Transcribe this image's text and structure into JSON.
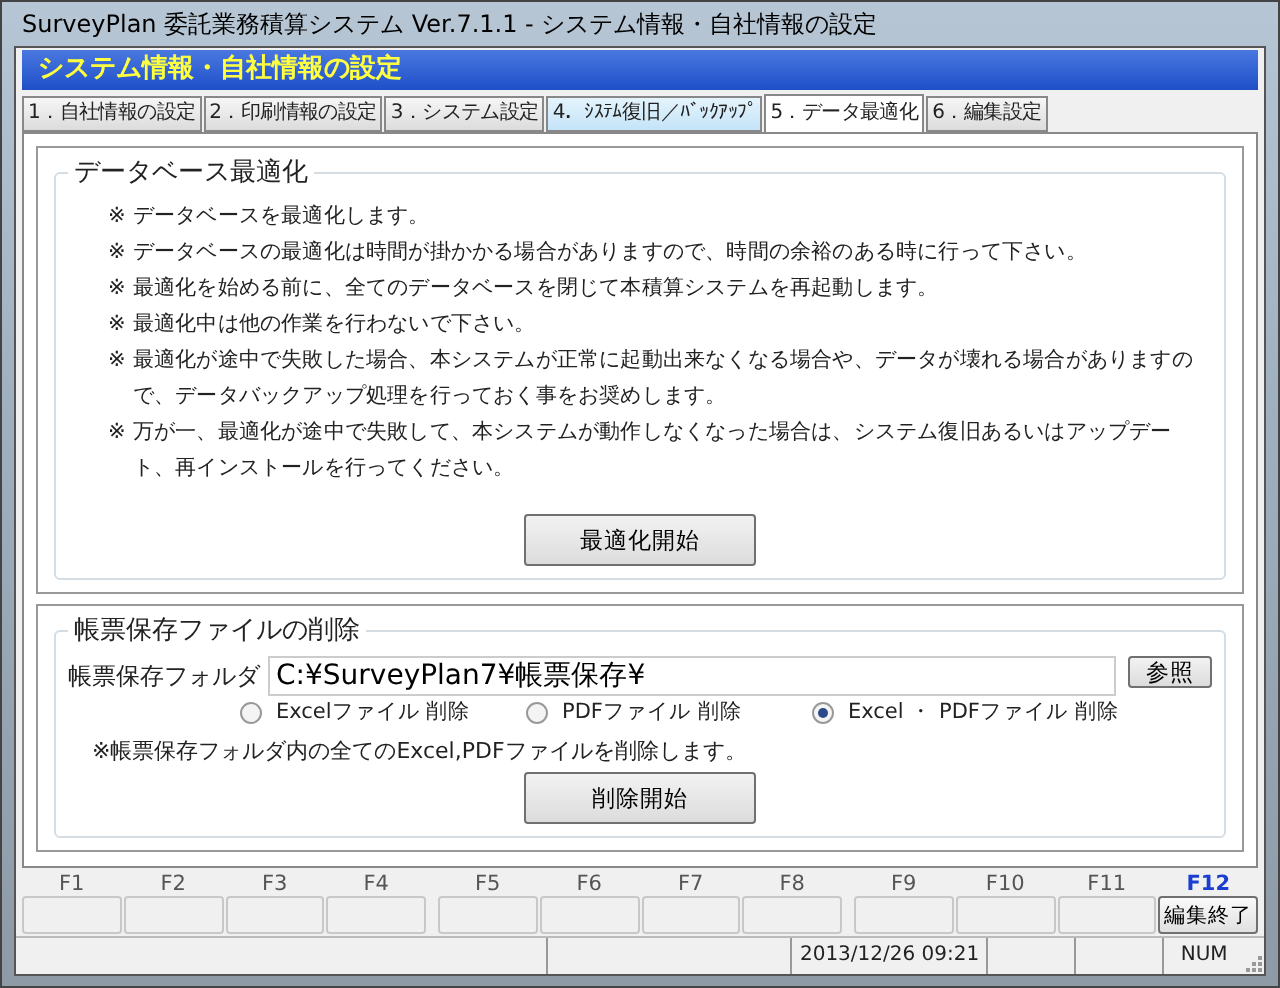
{
  "window": {
    "title": "SurveyPlan 委託業務積算システム Ver.7.1.1 - システム情報・自社情報の設定"
  },
  "header": {
    "title": "システム情報・自社情報の設定"
  },
  "tabs": [
    {
      "label": "1．自社情報の設定",
      "selected": false,
      "highlighted": false
    },
    {
      "label": "2．印刷情報の設定",
      "selected": false,
      "highlighted": false
    },
    {
      "label": "3．システム設定",
      "selected": false,
      "highlighted": false
    },
    {
      "label": "4．ｼｽﾃﾑ復旧／ﾊﾞｯｸｱｯﾌﾟ",
      "selected": false,
      "highlighted": true
    },
    {
      "label": "5．データ最適化",
      "selected": true,
      "highlighted": false
    },
    {
      "label": "6．編集設定",
      "selected": false,
      "highlighted": false
    }
  ],
  "optimize": {
    "title": "データベース最適化",
    "notes": [
      {
        "mark": "※",
        "text": "データベースを最適化します。"
      },
      {
        "mark": "※",
        "text": "データベースの最適化は時間が掛かかる場合がありますので、時間の余裕のある時に行って下さい。"
      },
      {
        "mark": "※",
        "text": "最適化を始める前に、全てのデータベースを閉じて本積算システムを再起動します。"
      },
      {
        "mark": "※",
        "text": "最適化中は他の作業を行わないで下さい。"
      },
      {
        "mark": "※",
        "text": "最適化が途中で失敗した場合、本システムが正常に起動出来なくなる場合や、データが壊れる場合がありますので、データバックアップ処理を行っておく事をお奨めします。"
      },
      {
        "mark": "※",
        "text": "万が一、最適化が途中で失敗して、本システムが動作しなくなった場合は、システム復旧あるいはアップデート、再インストールを行ってください。"
      }
    ],
    "button": "最適化開始"
  },
  "delete": {
    "title": "帳票保存ファイルの削除",
    "folder_label": "帳票保存フォルダ",
    "folder_value": "C:¥SurveyPlan7¥帳票保存¥",
    "browse_button": "参照",
    "options": [
      {
        "label": "Excelファイル 削除",
        "selected": false
      },
      {
        "label": "PDFファイル 削除",
        "selected": false
      },
      {
        "label": "Excel ・ PDFファイル 削除",
        "selected": true
      }
    ],
    "note": "※帳票保存フォルダ内の全てのExcel,PDFファイルを削除します。",
    "button": "削除開始"
  },
  "function_keys": [
    {
      "key": "F1",
      "enabled": false
    },
    {
      "key": "F2",
      "enabled": false
    },
    {
      "key": "F3",
      "enabled": false
    },
    {
      "key": "F4",
      "enabled": false
    },
    {
      "key": "F5",
      "enabled": false
    },
    {
      "key": "F6",
      "enabled": false
    },
    {
      "key": "F7",
      "enabled": false
    },
    {
      "key": "F8",
      "enabled": false
    },
    {
      "key": "F9",
      "enabled": false
    },
    {
      "key": "F10",
      "enabled": false
    },
    {
      "key": "F11",
      "enabled": false
    },
    {
      "key": "F12",
      "enabled": true,
      "button": "編集終了"
    }
  ],
  "status_bar": {
    "datetime": "2013/12/26  09:21",
    "num": "NUM"
  }
}
